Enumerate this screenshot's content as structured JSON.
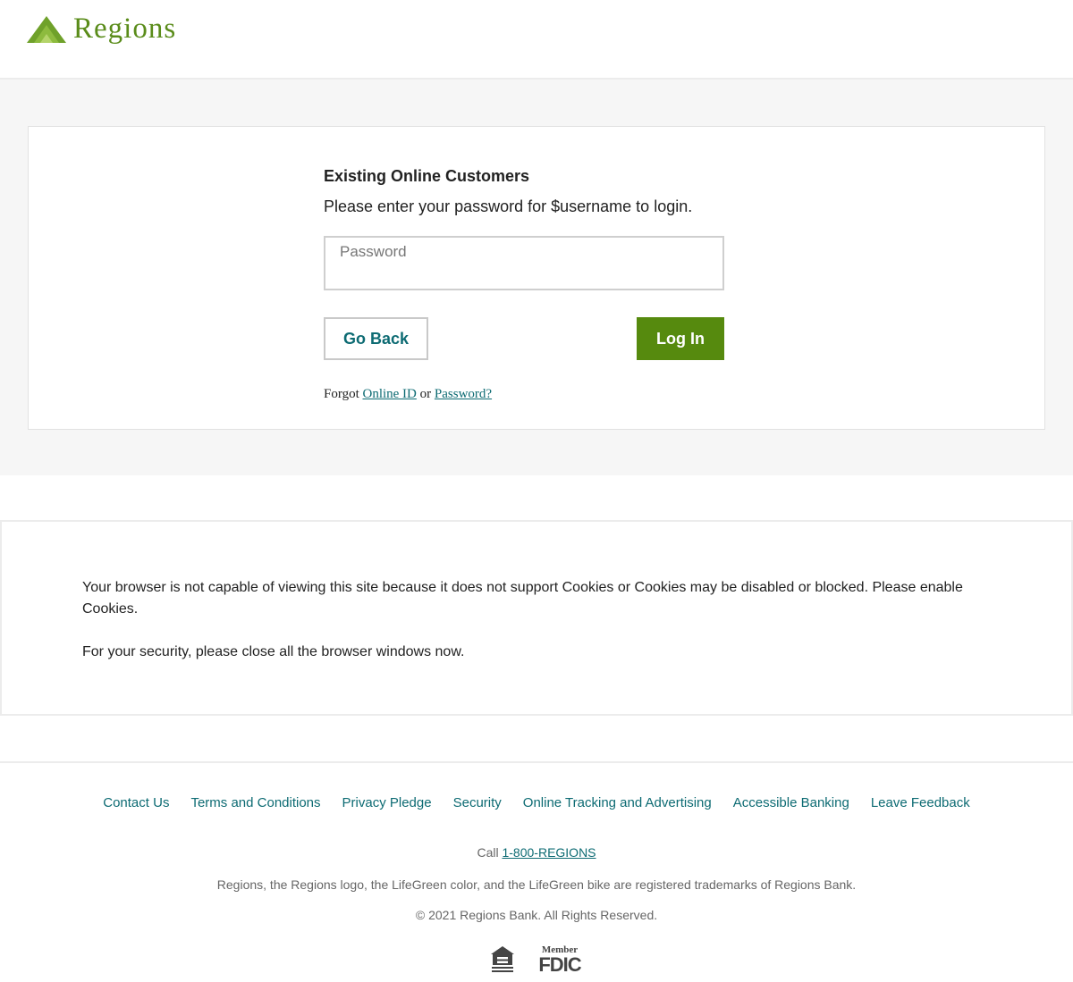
{
  "brand": {
    "name": "Regions",
    "color": "#5a8c1a"
  },
  "login": {
    "title": "Existing Online Customers",
    "subtitle": "Please enter your password for $username to login.",
    "password_label": "Password",
    "go_back_label": "Go Back",
    "login_label": "Log In",
    "forgot_prefix": "Forgot",
    "forgot_online_id": "Online ID",
    "forgot_or": "or",
    "forgot_password": "Password?"
  },
  "notice": {
    "cookies_message": "Your browser is not capable of viewing this site because it does not support Cookies or Cookies may be disabled or blocked. Please enable Cookies.",
    "security_message": "For your security, please close all the browser windows now."
  },
  "footer": {
    "links": [
      "Contact Us",
      "Terms and Conditions",
      "Privacy Pledge",
      "Security",
      "Online Tracking and Advertising",
      "Accessible Banking",
      "Leave Feedback"
    ],
    "call_prefix": "Call",
    "phone": "1-800-REGIONS",
    "trademark": "Regions, the Regions logo, the LifeGreen color, and the LifeGreen bike are registered trademarks of Regions Bank.",
    "copyright": "© 2021 Regions Bank. All Rights Reserved.",
    "badges": {
      "ehl_icon": "equal-housing-lender-icon",
      "fdic_member": "Member",
      "fdic_text": "FDIC"
    }
  }
}
